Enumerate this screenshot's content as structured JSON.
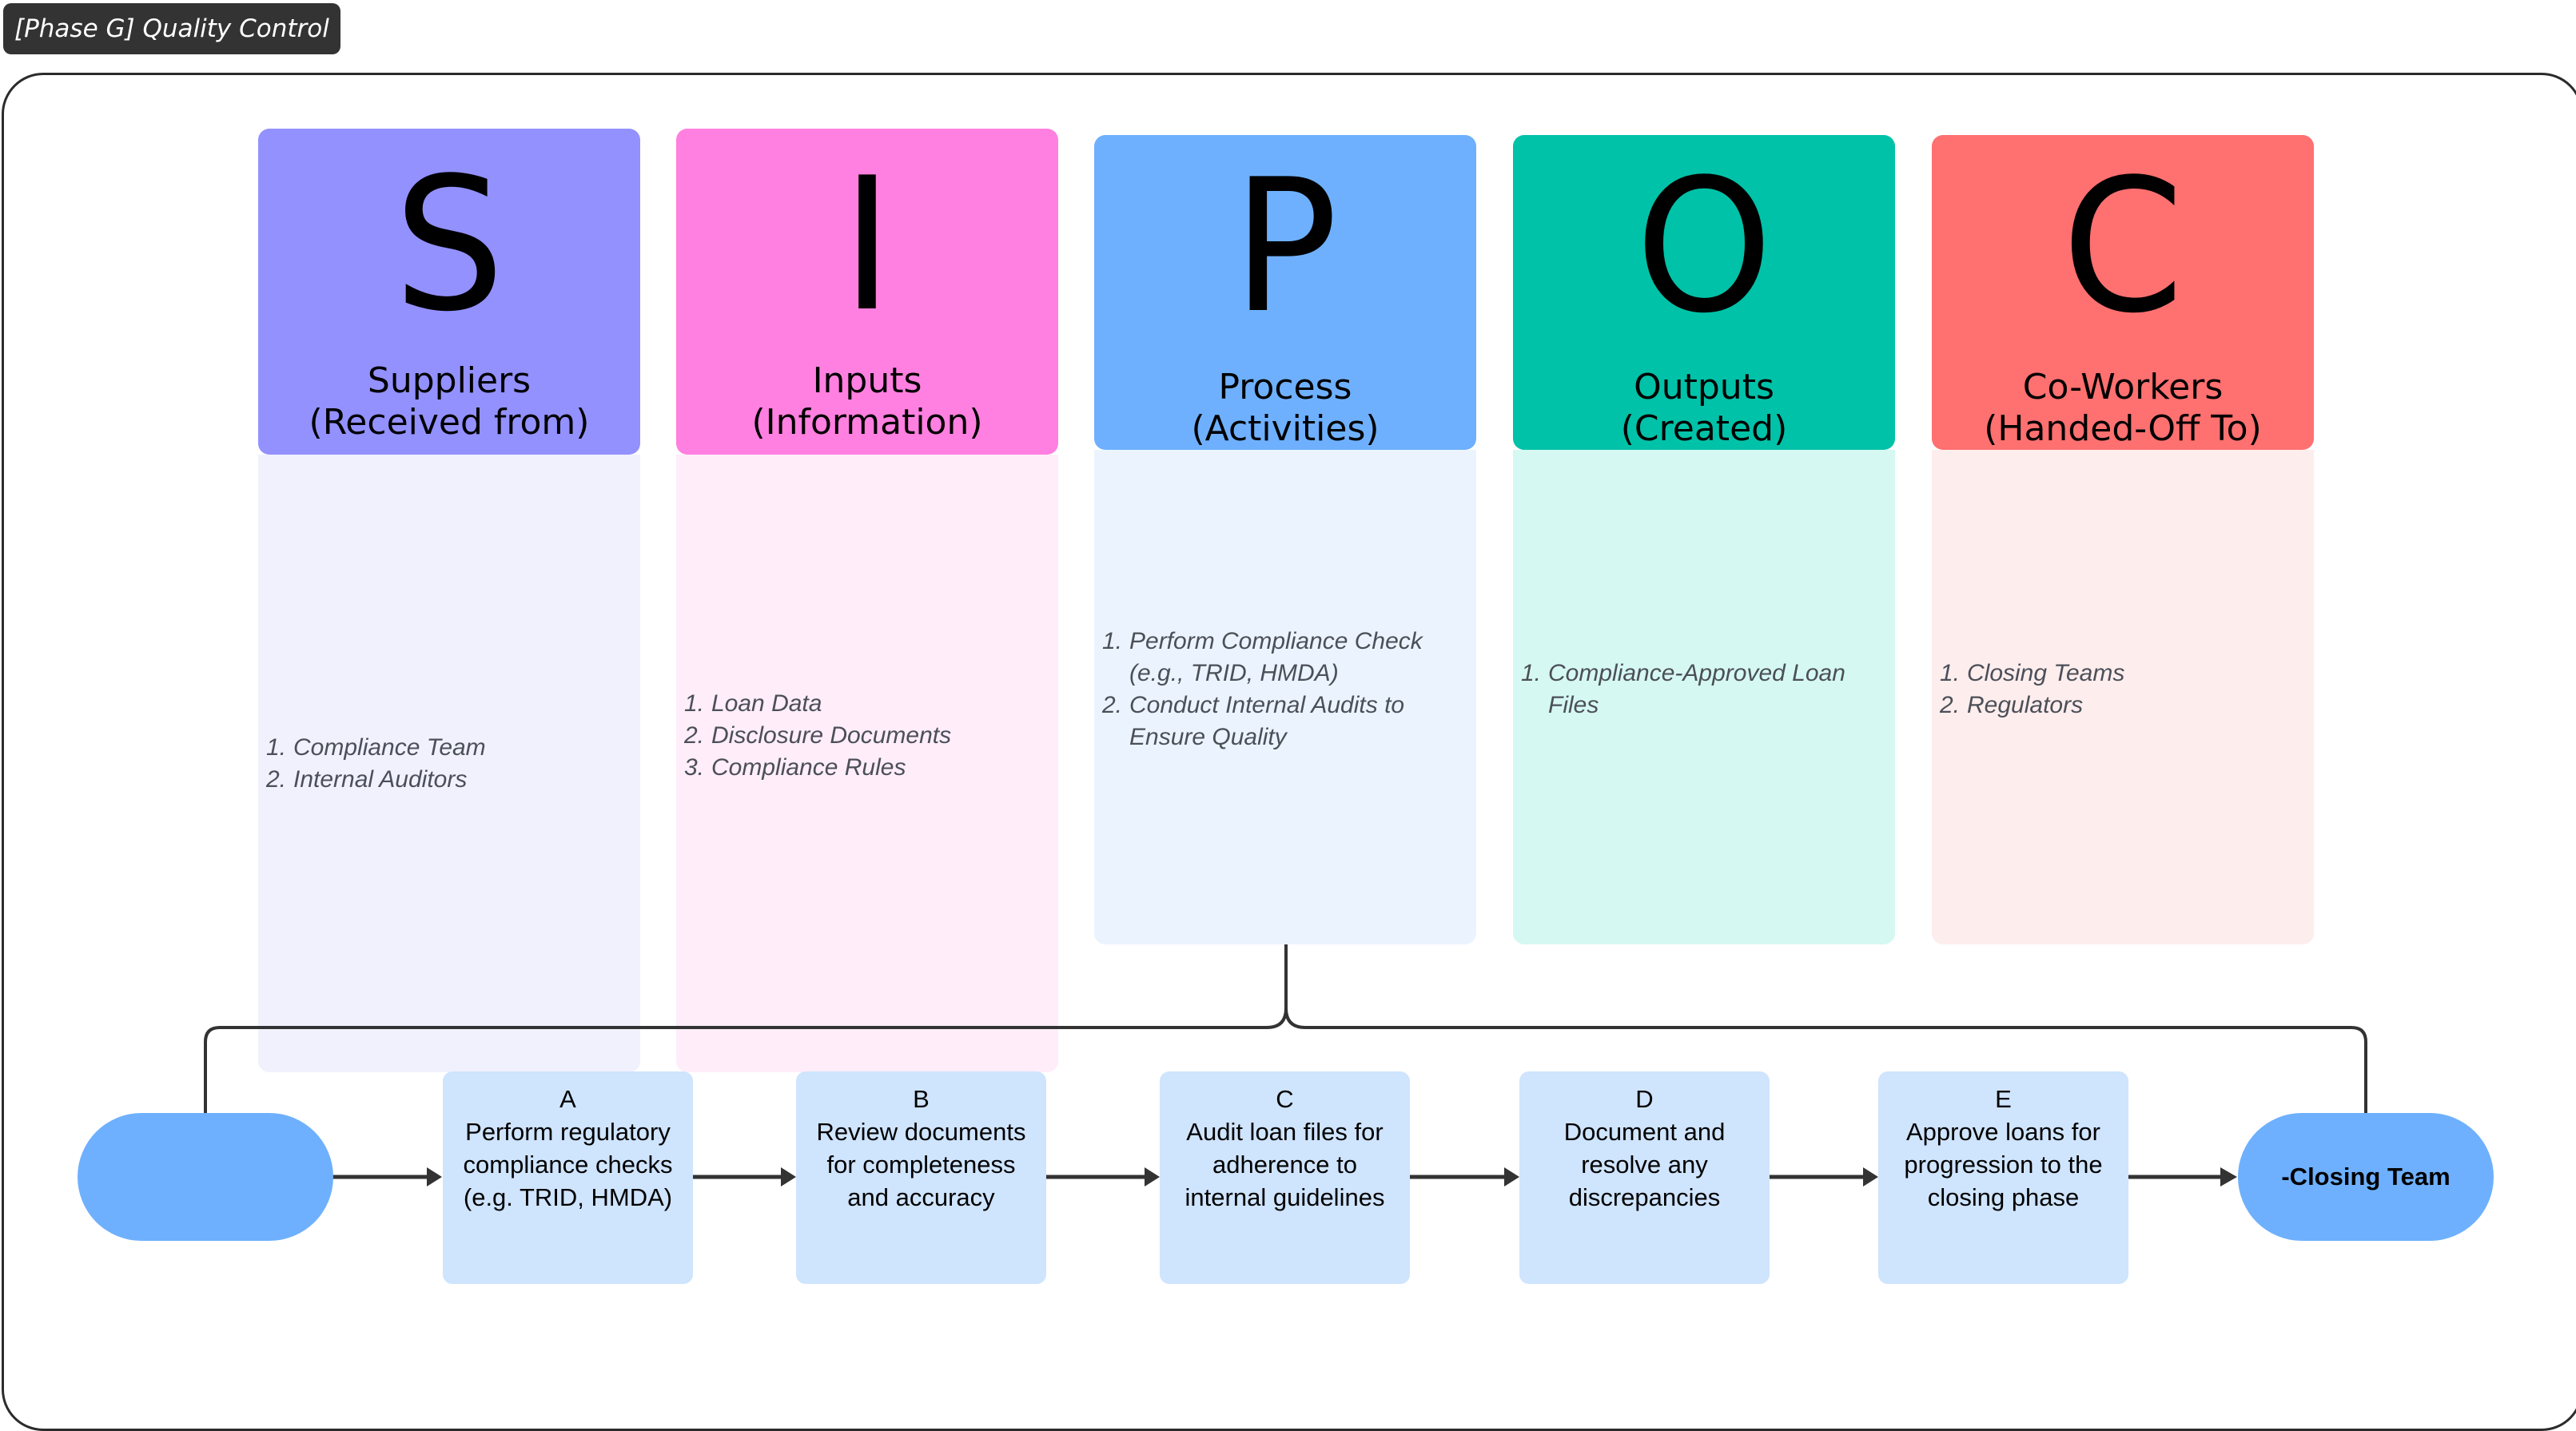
{
  "title": "[Phase G] Quality Control",
  "colors": {
    "title_bg": "#333333",
    "frame_border": "#2b2b2b",
    "connector": "#333333",
    "terminal_fill": "#6eb0fd",
    "step_fill": "#cfe4fd",
    "list_text": "#4b4f58"
  },
  "sipoc": [
    {
      "letter": "S",
      "label_line1": "Suppliers",
      "label_line2": "(Received from)",
      "header_color": "#9391fe",
      "body_color": "#f1f1fe",
      "items": [
        "Compliance Team",
        "Internal Auditors"
      ]
    },
    {
      "letter": "I",
      "label_line1": "Inputs",
      "label_line2": "(Information)",
      "header_color": "#ff80e0",
      "body_color": "#ffedfa",
      "items": [
        "Loan Data",
        "Disclosure Documents",
        "Compliance Rules"
      ]
    },
    {
      "letter": "P",
      "label_line1": "Process",
      "label_line2": "(Activities)",
      "header_color": "#6eb0fd",
      "body_color": "#ebf4fe",
      "items": [
        "Perform Compliance Check (e.g., TRID, HMDA)",
        "Conduct Internal Audits to Ensure Quality"
      ]
    },
    {
      "letter": "O",
      "label_line1": "Outputs",
      "label_line2": "(Created)",
      "header_color": "#00c2a8",
      "body_color": "#d6f8f2",
      "items": [
        "Compliance-Approved Loan Files"
      ]
    },
    {
      "letter": "C",
      "label_line1": "Co-Workers",
      "label_line2": "(Handed-Off To)",
      "header_color": "#ff7070",
      "body_color": "#feeded",
      "items": [
        "Closing Teams",
        "Regulators"
      ]
    }
  ],
  "flow": {
    "start_label": "",
    "end_label": "-Closing Team",
    "steps": [
      {
        "id": "A",
        "text": "Perform regulatory compliance checks (e.g. TRID, HMDA)"
      },
      {
        "id": "B",
        "text": "Review documents for completeness and accuracy"
      },
      {
        "id": "C",
        "text": "Audit loan files for adherence to internal guidelines"
      },
      {
        "id": "D",
        "text": "Document and resolve any discrepancies"
      },
      {
        "id": "E",
        "text": "Approve loans for progression to the closing phase"
      }
    ]
  }
}
